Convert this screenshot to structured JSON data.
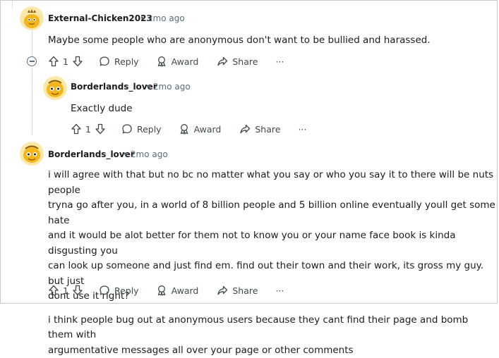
{
  "comments": [
    {
      "username": "External-Chicken2023",
      "time": "2mo ago",
      "body": "Maybe some people who are anonymous don't want to be bullied and harassed.",
      "votes": "1"
    },
    {
      "username": "Borderlands_lover",
      "time": "2mo ago",
      "body": "Exactly dude",
      "votes": "1"
    },
    {
      "username": "Borderlands_lover",
      "time": "2mo ago",
      "paragraphs": [
        [
          "i will agree with that but no bc no matter what you say or who you say it to there will be nuts people",
          "tryna go after you, in a world of 8 billion people and 5 billion online eventually youll get some hate",
          "and it would be alot better for them not to know you or your name face book is kinda disgusting you",
          "can look up someone and just find em. find out their town and their work, its gross my guy. but just",
          "dont use it right?"
        ],
        [
          "i think people bug out at anonymous users because they cant find their page and bomb them with",
          "argumentative messages all over your page or other comments"
        ]
      ],
      "votes": "1"
    }
  ],
  "labels": {
    "separator": "•",
    "reply": "Reply",
    "award": "Award",
    "share": "Share",
    "more": "···"
  },
  "icons": [
    "upvote-icon",
    "downvote-icon",
    "reply-icon",
    "award-icon",
    "share-icon",
    "more-icon",
    "collapse-icon"
  ],
  "colors": {
    "text": "#1c1c1c",
    "meta": "#576f76",
    "thread_line": "#d6dadc",
    "avatar": "#f5b61b"
  }
}
